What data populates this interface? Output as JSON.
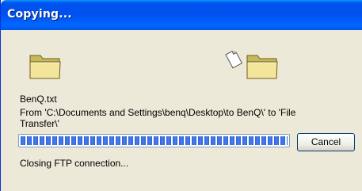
{
  "window": {
    "title": "Copying..."
  },
  "icons": {
    "source": "folder-icon",
    "destination": "folder-icon",
    "flying": "document-icon"
  },
  "file": {
    "name": "BenQ.txt",
    "path_line1": "From 'C:\\Documents and Settings\\benq\\Desktop\\to BenQ\\' to 'File",
    "path_line2": "Transfer\\'"
  },
  "progress": {
    "fraction": 1.0
  },
  "buttons": {
    "cancel_label": "Cancel"
  },
  "status": {
    "text": "Closing FTP connection..."
  },
  "colors": {
    "titlebar": "#0055e5",
    "progress": "#2f5fd6",
    "face": "#ece9d8"
  }
}
